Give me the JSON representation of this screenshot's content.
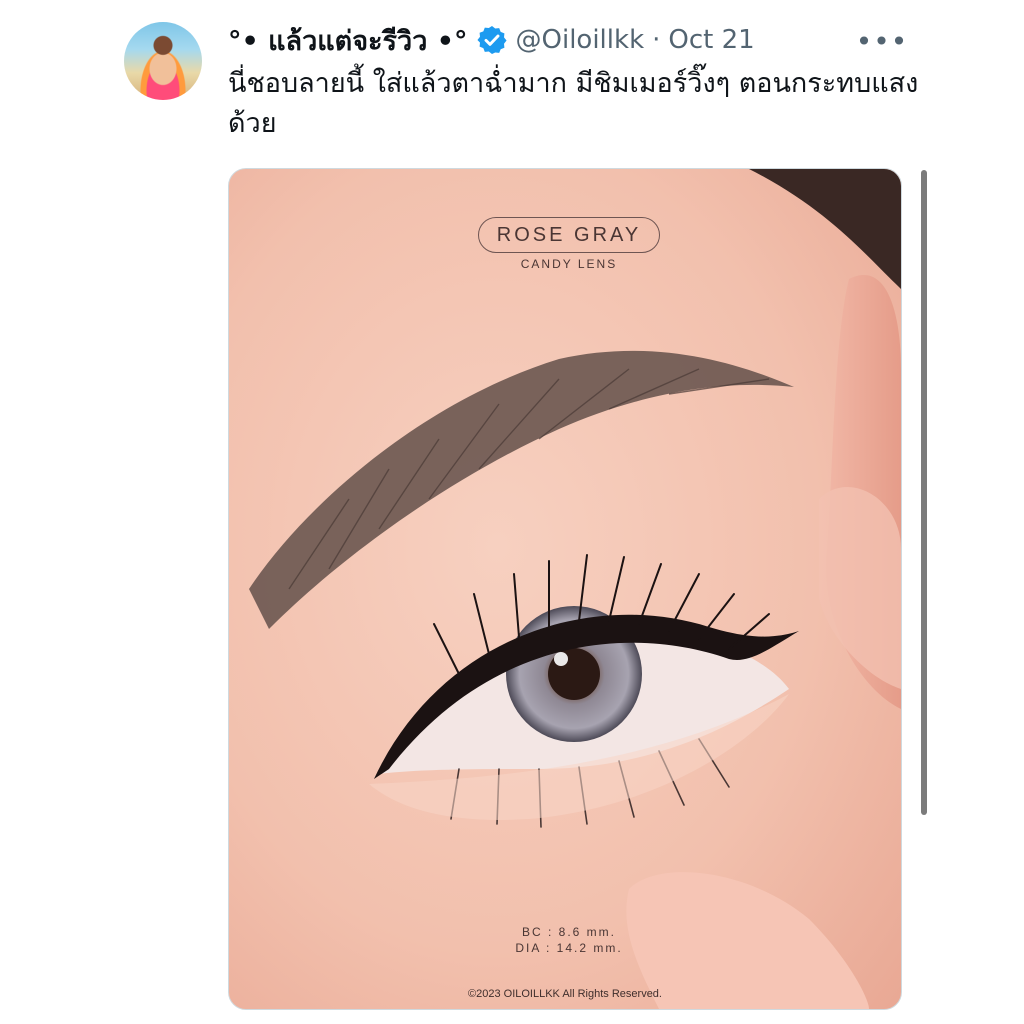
{
  "tweet": {
    "display_name": "°• แล้วแต่จะรีวิว •°",
    "handle": "@Oiloillkk",
    "separator": "·",
    "date": "Oct 21",
    "more_label": "•••",
    "text": "นี่ชอบลายนี้ ใส่แล้วตาฉ่ำมาก มีชิมเมอร์วิ๊งๆ ตอนกระทบแสงด้วย",
    "verified": true
  },
  "media": {
    "brand_title": "ROSE GRAY",
    "brand_subtitle": "CANDY LENS",
    "spec_bc": "BC : 8.6 mm.",
    "spec_dia": "DIA : 14.2 mm.",
    "copyright": "©2023 OILOILLKK All Rights Reserved."
  },
  "colors": {
    "verified_badge": "#1d9bf0",
    "secondary_text": "#536471",
    "primary_text": "#0f1419"
  },
  "icons": {
    "badge": "verified-badge-icon",
    "more": "more-options-icon"
  }
}
